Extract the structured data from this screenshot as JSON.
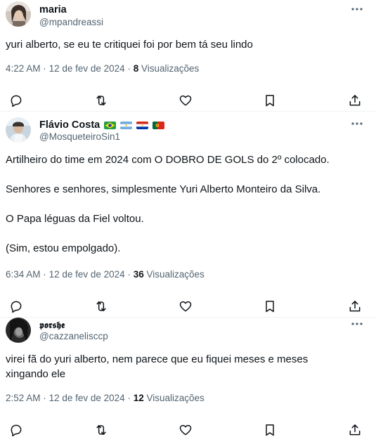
{
  "tweets": [
    {
      "display_name": "maria",
      "handle": "@mpandreassi",
      "text_lines": [
        "yuri alberto, se eu te critiquei foi por bem tá seu lindo"
      ],
      "time": "4:22 AM",
      "sep": "·",
      "date": "12 de fev de 2024",
      "views_count": "8",
      "views_label": "Visualizações"
    },
    {
      "display_name": "Flávio Costa",
      "handle": "@MosqueteiroSin1",
      "flags": [
        "brazil-flag-icon",
        "argentina-flag-icon",
        "paraguay-flag-icon",
        "portugal-flag-icon"
      ],
      "text_lines": [
        "Artilheiro do time em 2024 com O DOBRO DE GOLS do 2º colocado.",
        "Senhores e senhores, simplesmente Yuri Alberto Monteiro da Silva.",
        "O Papa léguas da Fiel voltou.",
        "(Sim, estou empolgado)."
      ],
      "time": "6:34 AM",
      "sep": "·",
      "date": "12 de fev de 2024",
      "views_count": "36",
      "views_label": "Visualizações"
    },
    {
      "display_name": "𝖕𝖔𝖗𝖘𝖍𝖊",
      "handle": "@cazzanelisccp",
      "text_lines": [
        "virei fã do yuri alberto, nem parece que eu fiquei meses e meses xingando ele"
      ],
      "time": "2:52 AM",
      "sep": "·",
      "date": "12 de fev de 2024",
      "views_count": "12",
      "views_label": "Visualizações"
    }
  ],
  "icons": {
    "reply": "reply-icon",
    "retweet": "retweet-icon",
    "like": "heart-icon",
    "bookmark": "bookmark-icon",
    "share": "share-icon",
    "more": "more-dots-icon"
  },
  "colors": {
    "text": "#0f1419",
    "secondary": "#536471",
    "divider": "#eff3f4"
  }
}
